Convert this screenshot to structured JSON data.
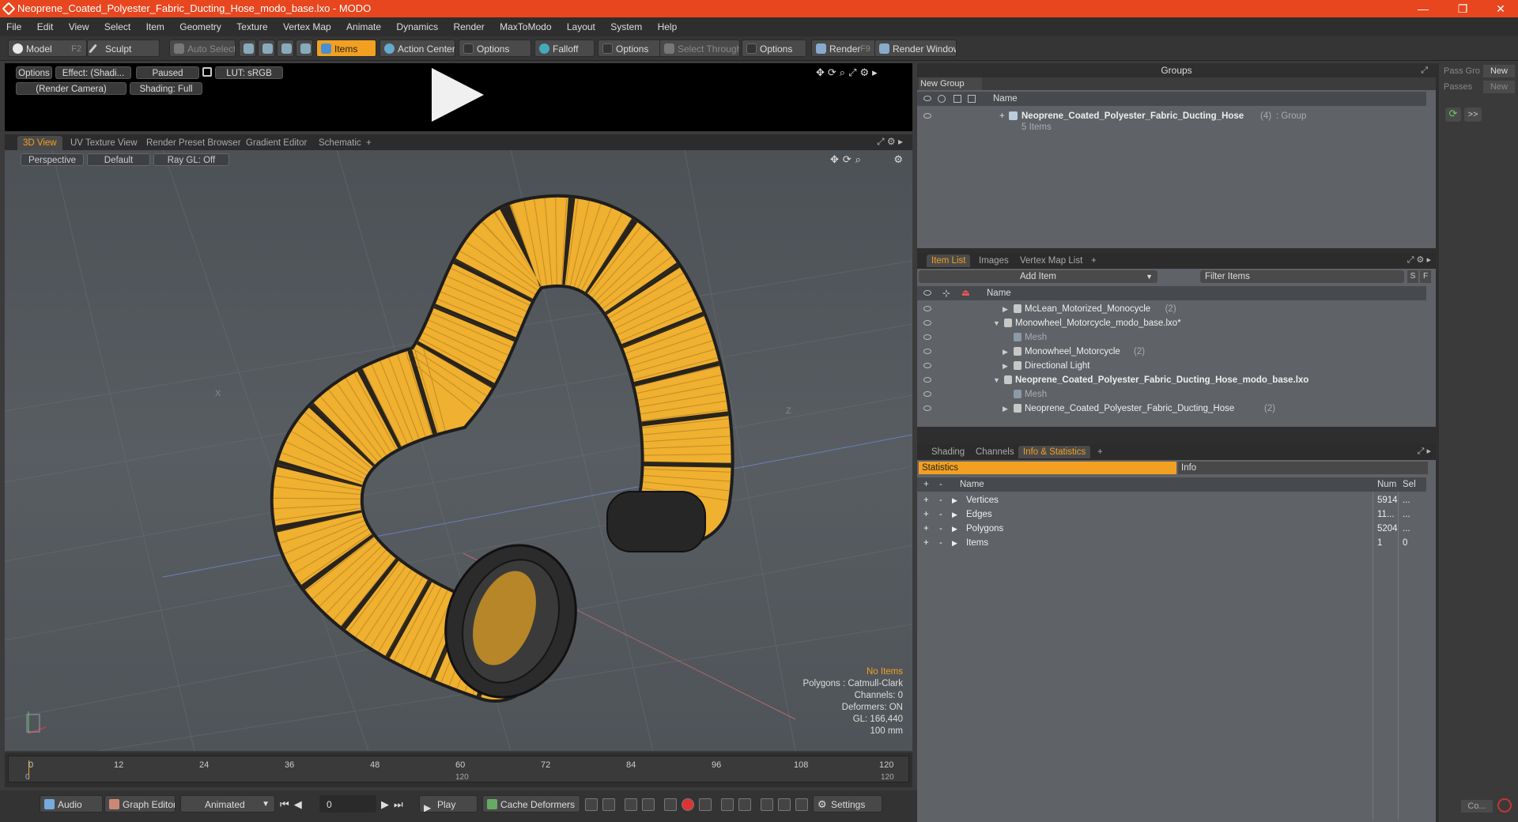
{
  "window": {
    "title": "Neoprene_Coated_Polyester_Fabric_Ducting_Hose_modo_base.lxo - MODO",
    "minimize": "—",
    "maximize": "❐",
    "close": "✕"
  },
  "menu": [
    "File",
    "Edit",
    "View",
    "Select",
    "Item",
    "Geometry",
    "Texture",
    "Vertex Map",
    "Animate",
    "Dynamics",
    "Render",
    "MaxToModo",
    "Layout",
    "System",
    "Help"
  ],
  "toolbar": {
    "model": "Model",
    "model_key": "F2",
    "sculpt": "Sculpt",
    "auto_select": "Auto Select",
    "items": "Items",
    "action_center": "Action Center",
    "options1": "Options",
    "falloff": "Falloff",
    "options2": "Options",
    "select_through": "Select Through",
    "options3": "Options",
    "render": "Render",
    "render_key": "F9",
    "render_window": "Render Window"
  },
  "preview": {
    "options": "Options",
    "effect": "Effect: (Shadi...",
    "paused": "Paused",
    "lut": "LUT: sRGB",
    "camera": "(Render Camera)",
    "shading": "Shading: Full"
  },
  "view_tabs": [
    "3D View",
    "UV Texture View",
    "Render Preset Browser",
    "Gradient Editor",
    "Schematic",
    "+"
  ],
  "viewport": {
    "perspective": "Perspective",
    "default": "Default",
    "raygl": "Ray GL: Off",
    "no_items": "No Items",
    "polygons": "Polygons : Catmull-Clark",
    "channels": "Channels: 0",
    "deformers": "Deformers: ON",
    "gl": "GL: 166,440",
    "unit": "100 mm",
    "axis_x": "X",
    "axis_z": "Z"
  },
  "timeline": {
    "ticks": [
      "0",
      "12",
      "24",
      "36",
      "48",
      "60",
      "72",
      "84",
      "96",
      "108",
      "120"
    ],
    "sub": [
      "0",
      "120",
      "120"
    ]
  },
  "bottom": {
    "audio": "Audio",
    "graph_editor": "Graph Editor",
    "animated": "Animated",
    "frame": "0",
    "play": "Play",
    "cache": "Cache Deformers",
    "settings": "Settings"
  },
  "groups": {
    "title": "Groups",
    "new_group": "New Group",
    "name_col": "Name",
    "item_name": "Neoprene_Coated_Polyester_Fabric_Ducting_Hose",
    "item_count": "(4)",
    "item_type": ": Group",
    "items_sub": "5 Items"
  },
  "side": {
    "pass_group": "Pass Gro",
    "passes": "Passes",
    "new1": "New",
    "new2": "New",
    "more": ">>",
    "co": "Co..."
  },
  "item_list": {
    "tabs": [
      "Item List",
      "Images",
      "Vertex Map List",
      "+"
    ],
    "add_item": "Add Item",
    "filter": "Filter Items",
    "s": "S",
    "f": "F",
    "name_col": "Name",
    "rows": [
      {
        "text": "McLean_Motorized_Monocycle",
        "count": "(2)",
        "indent": 126
      },
      {
        "text": "Monowheel_Motorcycle_modo_base.lxo*",
        "count": "",
        "indent": 114
      },
      {
        "text": "Mesh",
        "count": "",
        "indent": 126,
        "gray": true
      },
      {
        "text": "Monowheel_Motorcycle",
        "count": "(2)",
        "indent": 126
      },
      {
        "text": "Directional Light",
        "count": "",
        "indent": 126
      },
      {
        "text": "Neoprene_Coated_Polyester_Fabric_Ducting_Hose_modo_base.lxo",
        "count": "",
        "indent": 114,
        "bold": true
      },
      {
        "text": "Mesh",
        "count": "",
        "indent": 126,
        "gray": true
      },
      {
        "text": "Neoprene_Coated_Polyester_Fabric_Ducting_Hose",
        "count": "(2)",
        "indent": 126
      }
    ]
  },
  "stats": {
    "tabs": [
      "Shading",
      "Channels",
      "Info & Statistics",
      "+"
    ],
    "statistics": "Statistics",
    "info": "Info",
    "name_col": "Name",
    "num_col": "Num",
    "sel_col": "Sel",
    "rows": [
      {
        "name": "Vertices",
        "num": "5914",
        "sel": "..."
      },
      {
        "name": "Edges",
        "num": "11...",
        "sel": "..."
      },
      {
        "name": "Polygons",
        "num": "5204",
        "sel": "..."
      },
      {
        "name": "Items",
        "num": "1",
        "sel": "0"
      }
    ]
  },
  "colors": {
    "accent": "#f2a022",
    "title_bar": "#e8461e",
    "hose": "#f0b030"
  }
}
